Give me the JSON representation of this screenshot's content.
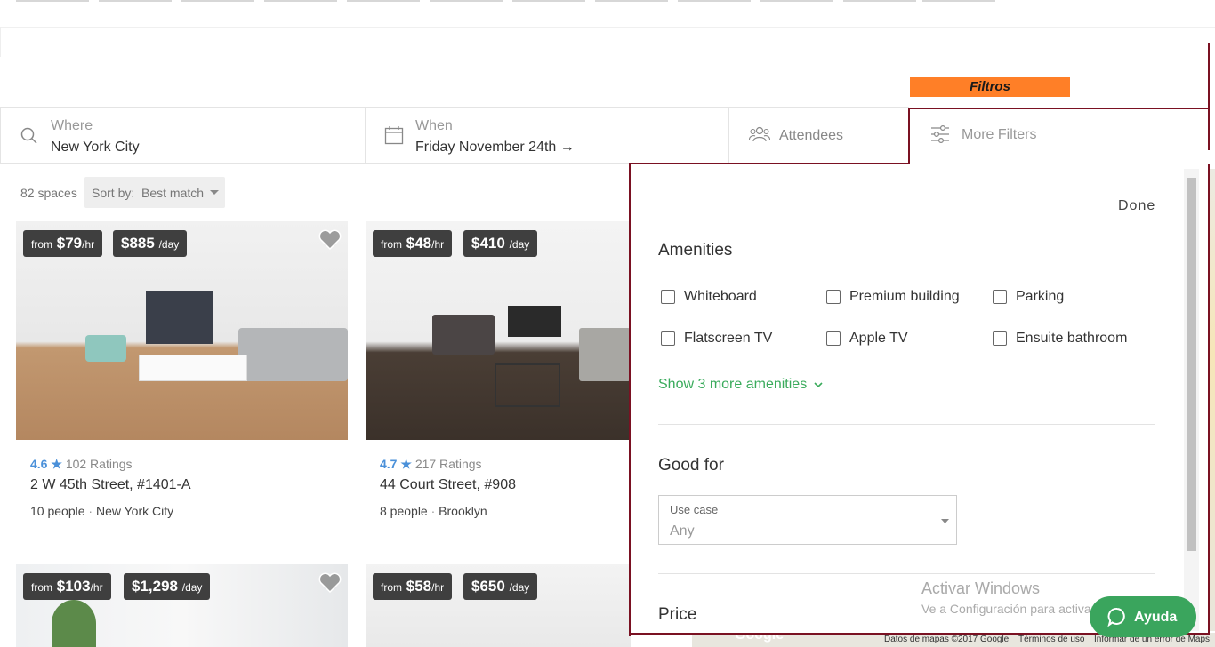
{
  "overlay_tag": "Filtros",
  "search": {
    "where_label": "Where",
    "where_value": "New York City",
    "when_label": "When",
    "when_value": "Friday November 24th →",
    "attendees_label": "Attendees",
    "more_filters_label": "More Filters"
  },
  "results": {
    "count": "82 spaces",
    "sort_label": "Sort by:",
    "sort_value": "Best match"
  },
  "listings": [
    {
      "from_label": "from",
      "hourly": "$79",
      "hourly_unit": "/hr",
      "daily": "$885",
      "daily_unit": "/day",
      "rating": "4.6",
      "rating_count": "102 Ratings",
      "address": "2 W 45th Street, #1401-A",
      "people": "10 people",
      "area": "New York City"
    },
    {
      "from_label": "from",
      "hourly": "$48",
      "hourly_unit": "/hr",
      "daily": "$410",
      "daily_unit": "/day",
      "rating": "4.7",
      "rating_count": "217 Ratings",
      "address": "44 Court Street, #908",
      "people": "8 people",
      "area": "Brooklyn"
    },
    {
      "from_label": "from",
      "hourly": "$103",
      "hourly_unit": "/hr",
      "daily": "$1,298",
      "daily_unit": "/day"
    },
    {
      "from_label": "from",
      "hourly": "$58",
      "hourly_unit": "/hr",
      "daily": "$650",
      "daily_unit": "/day"
    }
  ],
  "filters": {
    "done_label": "Done",
    "amenities_title": "Amenities",
    "amenities": [
      "Whiteboard",
      "Premium building",
      "Parking",
      "Flatscreen TV",
      "Apple TV",
      "Ensuite bathroom"
    ],
    "show_more": "Show 3 more amenities",
    "good_for_title": "Good for",
    "use_case_label": "Use case",
    "use_case_value": "Any",
    "price_title": "Price"
  },
  "watermark": {
    "line1": "Activar Windows",
    "line2": "Ve a Configuración para activar Windows."
  },
  "help_button": "Ayuda",
  "map_footer": {
    "data": "Datos de mapas ©2017 Google",
    "terms": "Términos de uso",
    "report": "Informar de un error de Maps",
    "logo": "Google"
  },
  "colors": {
    "accent_green": "#3aab5c",
    "rating_blue": "#4a90d9",
    "frame": "#7a1122",
    "tag": "#ff7f27",
    "badge": "#3f3f3f"
  }
}
